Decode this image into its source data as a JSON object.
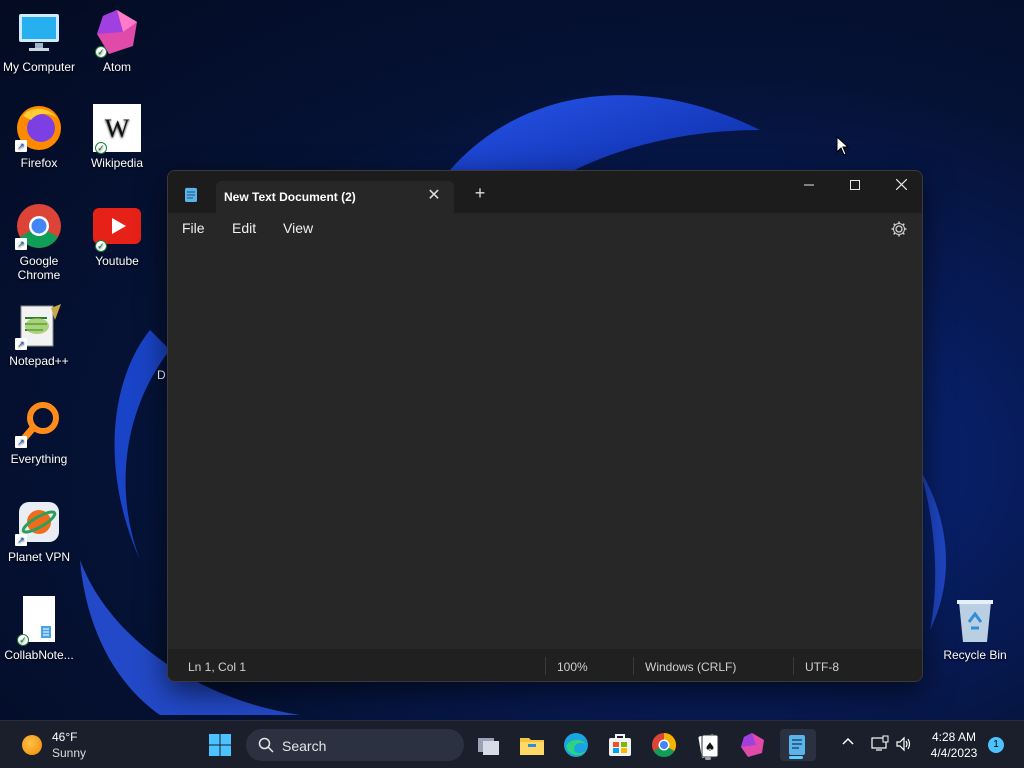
{
  "desktop": {
    "icons": [
      {
        "label": "My Computer"
      },
      {
        "label": "Atom"
      },
      {
        "label": "Firefox"
      },
      {
        "label": "Wikipedia"
      },
      {
        "label": "Google Chrome"
      },
      {
        "label": "Youtube"
      },
      {
        "label": "Notepad++"
      },
      {
        "label": "Everything"
      },
      {
        "label": "Planet VPN"
      },
      {
        "label": "CollabNote..."
      },
      {
        "label": "Recycle Bin"
      }
    ],
    "stray_label": "D"
  },
  "notepad": {
    "tab_title": "New Text Document (2)",
    "menu": {
      "file": "File",
      "edit": "Edit",
      "view": "View"
    },
    "editor_content": "",
    "status": {
      "position": "Ln 1, Col 1",
      "zoom": "100%",
      "line_ending": "Windows (CRLF)",
      "encoding": "UTF-8"
    }
  },
  "taskbar": {
    "weather": {
      "temperature": "46°F",
      "condition": "Sunny"
    },
    "search_label": "Search",
    "clock": {
      "time": "4:28 AM",
      "date": "4/4/2023"
    },
    "notification_count": "1"
  },
  "colors": {
    "accent": "#60cdff",
    "window_bg": "#272727",
    "titlebar_bg": "#1c1c1c",
    "taskbar_bg": "#1a1f2b"
  }
}
